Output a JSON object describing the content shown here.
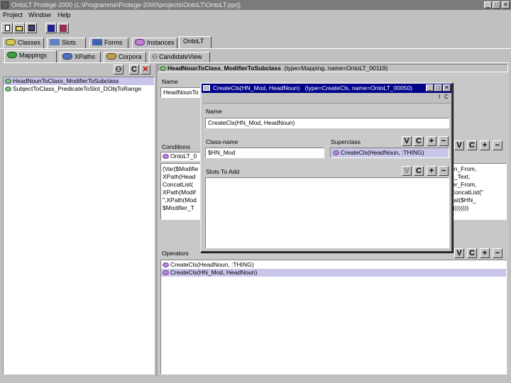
{
  "window": {
    "title": "OntoLT Protégé-2000  (L:\\Programme\\Protege-2000\\projects\\OntoLT\\OntoLT.pprj)",
    "controls": [
      "_",
      "□",
      "✕"
    ]
  },
  "menu": [
    "Project",
    "Window",
    "Help"
  ],
  "toolbar": [
    "new-file",
    "open-folder",
    "save",
    "cut",
    "copy"
  ],
  "main_tabs": [
    {
      "label": "Classes"
    },
    {
      "label": "Slots"
    },
    {
      "label": "Forms"
    },
    {
      "label": "Instances"
    },
    {
      "label": "OntoLT"
    }
  ],
  "sub_tabs": [
    {
      "label": "Mappings"
    },
    {
      "label": "XPaths"
    },
    {
      "label": "Corpora"
    },
    {
      "label": "CandidateView"
    }
  ],
  "left_panel": {
    "buttons": [
      "C",
      "✕"
    ],
    "items": [
      {
        "label": "HeadNounToClass_ModifierToSubclass",
        "selected": true
      },
      {
        "label": "SubjectToClass_PredicateToSlot_DObjToRange",
        "selected": false
      }
    ]
  },
  "instance_header": {
    "name": "HeadNounToClass_ModifierToSubclass",
    "meta": "(type=Mapping, name=OntoLT_00119)"
  },
  "form": {
    "name_label": "Name",
    "name_value": "HeadNounTo",
    "conditions_label": "Conditions",
    "condition_chip": "OntoLT_0",
    "conditions_left": [
      "(Var($Modifie",
      "XPath(Head",
      "ConcatList(",
      "XPath(Modif",
      "\",XPath(Mod",
      "$Modifier_T"
    ],
    "conditions_right": [
      "un_From,",
      "n_Text,",
      "ier_From,",
      "ConcatList(\"",
      "cat($HN_",
      ")))))))))"
    ],
    "operators_label": "Operators",
    "operators": [
      {
        "label": "CreateCls(HeadNoun, :THING)",
        "selected": false
      },
      {
        "label": "CreateCls(HN_Mod, HeadNoun)",
        "selected": true
      }
    ],
    "side_buttons": [
      "V",
      "C",
      "+",
      "−"
    ]
  },
  "dialog": {
    "title": "CreateCls(HN_Mod, HeadNoun)",
    "title_meta": "(type=CreateCls, name=OntoLT_00050)",
    "controls": [
      "_",
      "□",
      "✕"
    ],
    "sub_icons": [
      "I",
      "C"
    ],
    "name_label": "Name",
    "name_value": "CreateCls(HN_Mod, HeadNoun)",
    "classname_label": "Class-name",
    "classname_value": "$HN_Mod",
    "superclass_label": "Superclass",
    "superclass_value": "CreateCls(HeadNoun, :THING)",
    "slots_label": "Slots To Add",
    "buttons": [
      "V",
      "C",
      "+",
      "−"
    ]
  }
}
